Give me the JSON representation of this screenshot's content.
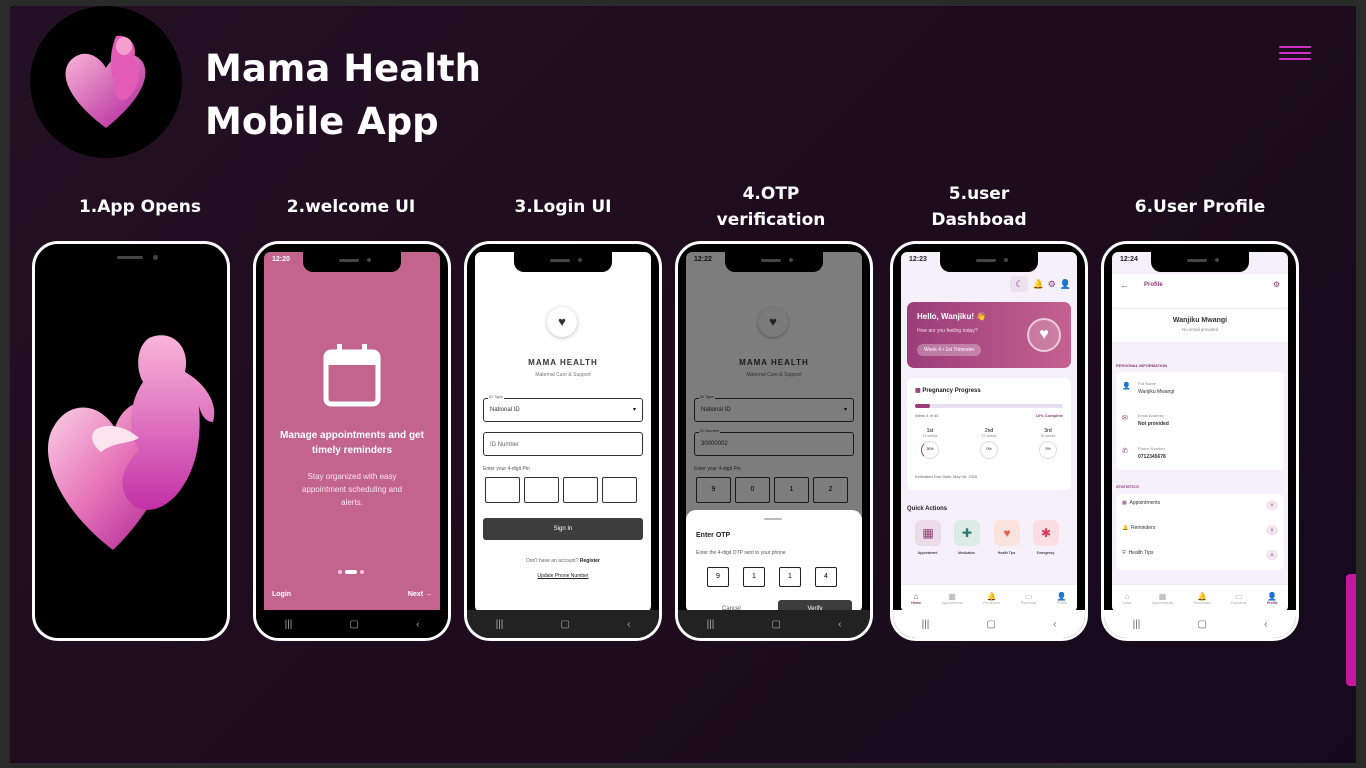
{
  "header": {
    "title_line1": "Mama Health",
    "title_line2": "Mobile App"
  },
  "steps": [
    {
      "label": "1.App Opens"
    },
    {
      "label": "2.welcome UI"
    },
    {
      "label": "3.Login UI"
    },
    {
      "label_line1": "4.OTP",
      "label_line2": "verification"
    },
    {
      "label_line1": "5.user",
      "label_line2": "Dashboad"
    },
    {
      "label": "6.User Profile"
    }
  ],
  "welcome": {
    "time": "12:20",
    "heading": "Manage appointments and get timely reminders",
    "body": "Stay organized with easy appointment scheduling and alerts.",
    "login": "Login",
    "next": "Next"
  },
  "login": {
    "app_name": "MAMA HEALTH",
    "subtitle": "Maternal Care & Support",
    "id_type_label": "ID Type",
    "id_type_value": "National ID",
    "id_number_placeholder": "ID Number",
    "pin_label": "Enter your 4-digit Pin",
    "sign_in": "Sign In",
    "no_account": "Don't have an account?",
    "register": "Register",
    "update_phone": "Update Phone Number"
  },
  "otp": {
    "time": "12:22",
    "app_name": "MAMA HEALTH",
    "subtitle": "Maternal Care & Support",
    "id_type_label": "ID Type",
    "id_type_value": "National ID",
    "id_number_label": "ID Number",
    "id_number_value": "30000002",
    "pin_label": "Enter your 4-digit Pin",
    "pin_digits": [
      "9",
      "0",
      "1",
      "2"
    ],
    "sheet_title": "Enter OTP",
    "sheet_desc": "Enter the 4-digit OTP sent to your phone",
    "otp_digits": [
      "9",
      "1",
      "1",
      "4"
    ],
    "cancel": "Cancel",
    "verify": "Verify"
  },
  "dashboard": {
    "time": "12:23",
    "greeting": "Hello, Wanjiku! 👋",
    "how": "How are you feeling today?",
    "week_chip": "Week 4 • 1st Trimester",
    "progress_title": "Pregnancy Progress",
    "week_of": "Week 4 of 40",
    "complete": "10% Complete",
    "progress": 0.1,
    "trimesters": [
      {
        "name": "1st",
        "weeks": "13 weeks",
        "pct": "30%"
      },
      {
        "name": "2nd",
        "weeks": "27 weeks",
        "pct": "0%"
      },
      {
        "name": "3rd",
        "weeks": "40 weeks",
        "pct": "0%"
      }
    ],
    "due": "Estimated Due Date: May 08, 2026",
    "quick_actions_title": "Quick Actions",
    "quick_actions": [
      "Appointment",
      "Medication",
      "Health Tips",
      "Emergency"
    ],
    "nav": [
      "Home",
      "Appointments",
      "Reminders",
      "Payments",
      "Profile"
    ]
  },
  "profile": {
    "time": "12:24",
    "title": "Profile",
    "name": "Wanjiku Mwangi",
    "email_note": "No email provided",
    "personal_info": "PERSONAL INFORMATION",
    "full_name_label": "Full Name",
    "full_name": "Wanjiku Mwangi",
    "email_label": "Email Address",
    "email_value": "Not provided",
    "phone_label": "Phone Number",
    "phone_value": "0712345678",
    "statistics": "STATISTICS",
    "stats": [
      {
        "label": "Appointments",
        "count": "0"
      },
      {
        "label": "Reminders",
        "count": "0"
      },
      {
        "label": "Health Tips",
        "count": "0"
      }
    ],
    "nav": [
      "Home",
      "Appointments",
      "Reminders",
      "Payments",
      "Profile"
    ]
  },
  "colors": {
    "accent": "#d42ec8",
    "pink": "#c2648e",
    "dark": "#3d3d3d"
  }
}
